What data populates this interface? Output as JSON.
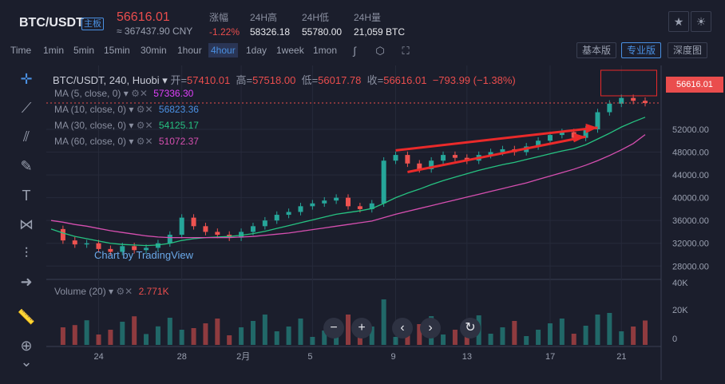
{
  "header": {
    "pair": "BTC/USDT",
    "badge": "主板",
    "price": "56616.01",
    "cny": "≈ 367437.90 CNY",
    "stats": [
      {
        "label": "涨幅",
        "value": "-1.22%"
      },
      {
        "label": "24H高",
        "value": "58326.18"
      },
      {
        "label": "24H低",
        "value": "55780.00"
      },
      {
        "label": "24H量",
        "value": "21,059 BTC"
      }
    ]
  },
  "toolbar": {
    "timeframes": [
      "Time",
      "1min",
      "5min",
      "15min",
      "30min",
      "1hour",
      "4hour",
      "1day",
      "1week",
      "1mon"
    ],
    "active_timeframe": "4hour",
    "versions": [
      "基本版",
      "专业版",
      "深度图"
    ],
    "active_version": "专业版"
  },
  "chart": {
    "symbol_line": "BTC/USDT, 240, Huobi",
    "ohlc": {
      "open_label": "开=",
      "open": "57410.01",
      "high_label": "高=",
      "high": "57518.00",
      "low_label": "低=",
      "low": "56017.78",
      "close_label": "收=",
      "close": "56616.01",
      "change": "−793.99 (−1.38%)"
    },
    "ma": [
      {
        "label": "MA (5, close, 0)",
        "value": "57336.30",
        "color": "#e040fb"
      },
      {
        "label": "MA (10, close, 0)",
        "value": "56823.36",
        "color": "#4a90e2"
      },
      {
        "label": "MA (30, close, 0)",
        "value": "54125.17",
        "color": "#26c281"
      },
      {
        "label": "MA (60, close, 0)",
        "value": "51072.37",
        "color": "#d64fb0"
      }
    ],
    "watermark": "Chart by TradingView",
    "price_tag": "56616.01",
    "volume_label": "Volume (20)",
    "volume_value": "2.771K",
    "up_color": "#26a69a",
    "down_color": "#ef5350"
  },
  "chart_data": {
    "type": "line",
    "title": "BTC/USDT, 240, Huobi",
    "x_ticks": [
      "24",
      "28",
      "2月",
      "5",
      "9",
      "13",
      "17",
      "21"
    ],
    "y_ticks": [
      28000,
      32000,
      36000,
      40000,
      44000,
      48000,
      52000
    ],
    "ylim": [
      26500,
      59000
    ],
    "volume_ticks": [
      "40K",
      "20K",
      "0"
    ],
    "series": [
      {
        "name": "BTC/USDT",
        "values": [
          34500,
          32500,
          31800,
          32000,
          31000,
          30500,
          31500,
          30800,
          31200,
          32000,
          33500,
          36500,
          35000,
          34000,
          33500,
          33000,
          34000,
          35000,
          36000,
          37000,
          37500,
          38500,
          39000,
          39500,
          40000,
          38500,
          38000,
          39000,
          46500,
          47500,
          46000,
          45000,
          46500,
          47500,
          47000,
          46500,
          47500,
          48000,
          48500,
          48000,
          49000,
          50000,
          51000,
          51500,
          50500,
          52000,
          55000,
          56500,
          57500,
          57000,
          56616
        ]
      },
      {
        "name": "MA (30, close, 0)",
        "values": [
          34500,
          33800,
          33200,
          32800,
          32400,
          32000,
          31800,
          31700,
          31600,
          31700,
          32000,
          32500,
          32800,
          33000,
          33100,
          33200,
          33400,
          33700,
          34100,
          34600,
          35100,
          35600,
          36100,
          36600,
          37100,
          37400,
          37700,
          38100,
          39000,
          40000,
          40800,
          41500,
          42300,
          43000,
          43600,
          44200,
          44800,
          45300,
          45800,
          46200,
          46700,
          47200,
          47700,
          48200,
          48600,
          49300,
          50300,
          51300,
          52400,
          53300,
          54125
        ]
      },
      {
        "name": "MA (60, close, 0)",
        "values": [
          36000,
          35700,
          35300,
          35000,
          34600,
          34200,
          33900,
          33600,
          33300,
          33100,
          33000,
          33000,
          33000,
          33000,
          33000,
          33000,
          33100,
          33200,
          33400,
          33600,
          33800,
          34100,
          34400,
          34700,
          35000,
          35300,
          35600,
          35900,
          36500,
          37100,
          37600,
          38100,
          38600,
          39100,
          39600,
          40100,
          40600,
          41100,
          41600,
          42100,
          42600,
          43200,
          43800,
          44400,
          45000,
          45700,
          46500,
          47400,
          48400,
          49500,
          51072
        ]
      }
    ]
  }
}
